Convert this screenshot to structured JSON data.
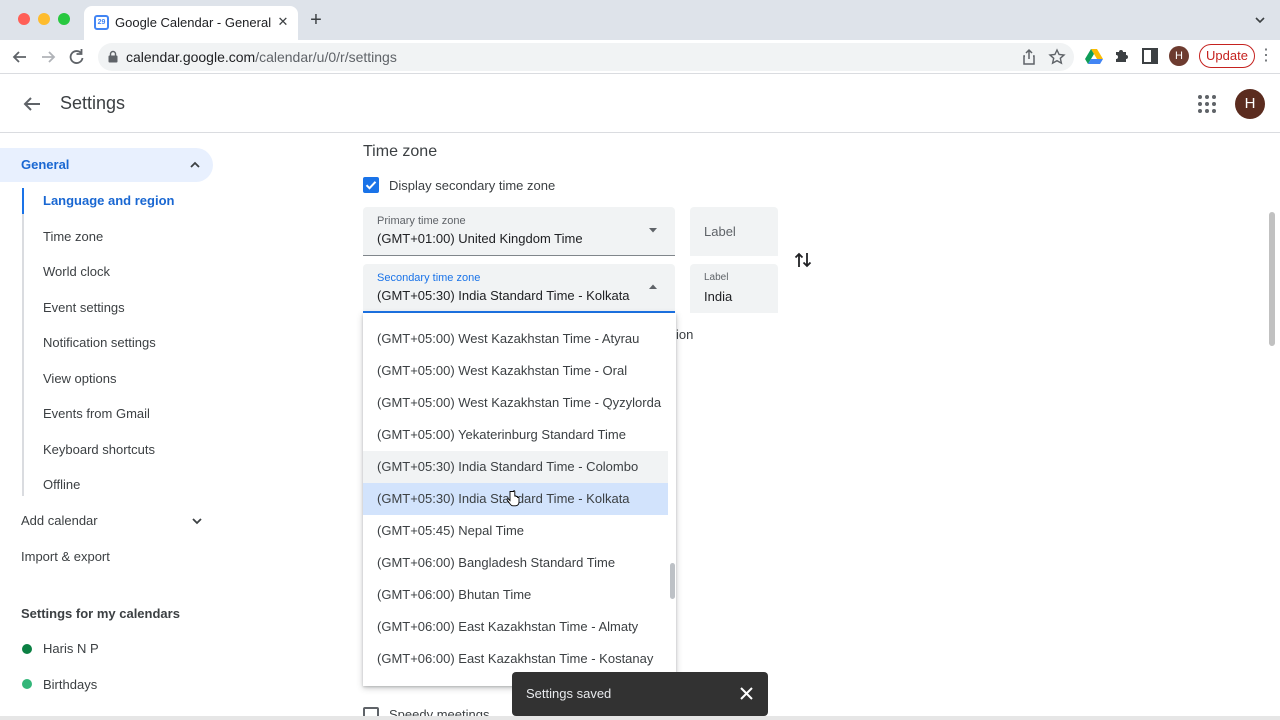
{
  "browser": {
    "tab_title": "Google Calendar - General setti",
    "tab_favicon_text": "29",
    "tab_close": "✕",
    "new_tab": "+",
    "url_host": "calendar.google.com",
    "url_path": "/calendar/u/0/r/settings",
    "profile_initial": "H",
    "update_label": "Update"
  },
  "header": {
    "title": "Settings",
    "avatar_initial": "H"
  },
  "nav": {
    "general_label": "General",
    "sub_items": [
      "Language and region",
      "Time zone",
      "World clock",
      "Event settings",
      "Notification settings",
      "View options",
      "Events from Gmail",
      "Keyboard shortcuts",
      "Offline"
    ],
    "add_calendar": "Add calendar",
    "import_export": "Import & export",
    "my_calendars_heading": "Settings for my calendars",
    "calendars": [
      {
        "name": "Haris N P",
        "color": "#0b8043"
      },
      {
        "name": "Birthdays",
        "color": "#33b679"
      }
    ]
  },
  "main": {
    "section_title": "Time zone",
    "display_secondary_label": "Display secondary time zone",
    "display_secondary_checked": true,
    "primary": {
      "label": "Primary time zone",
      "value": "(GMT+01:00) United Kingdom Time",
      "label_field_placeholder": "Label"
    },
    "secondary": {
      "label": "Secondary time zone",
      "value": "(GMT+05:30) India Standard Time - Kolkata",
      "label_field_label": "Label",
      "label_field_value": "India"
    },
    "partially_hidden_text": "ion",
    "bottom_checkbox_label": "Speedy meetings"
  },
  "dropdown": {
    "items": [
      "(GMT+05:00) West Kazakhstan Time - Atyrau",
      "(GMT+05:00) West Kazakhstan Time - Oral",
      "(GMT+05:00) West Kazakhstan Time - Qyzylorda",
      "(GMT+05:00) Yekaterinburg Standard Time",
      "(GMT+05:30) India Standard Time - Colombo",
      "(GMT+05:30) India Standard Time - Kolkata",
      "(GMT+05:45) Nepal Time",
      "(GMT+06:00) Bangladesh Standard Time",
      "(GMT+06:00) Bhutan Time",
      "(GMT+06:00) East Kazakhstan Time - Almaty",
      "(GMT+06:00) East Kazakhstan Time - Kostanay"
    ],
    "hovered_index": 4,
    "selected_index": 5
  },
  "snackbar": {
    "message": "Settings saved"
  },
  "colors": {
    "accent": "#1a73e8",
    "nav_active_bg": "#e8f0fe",
    "selected_option_bg": "#d2e3fc",
    "snackbar_bg": "#323232",
    "update_red": "#c5221f"
  }
}
